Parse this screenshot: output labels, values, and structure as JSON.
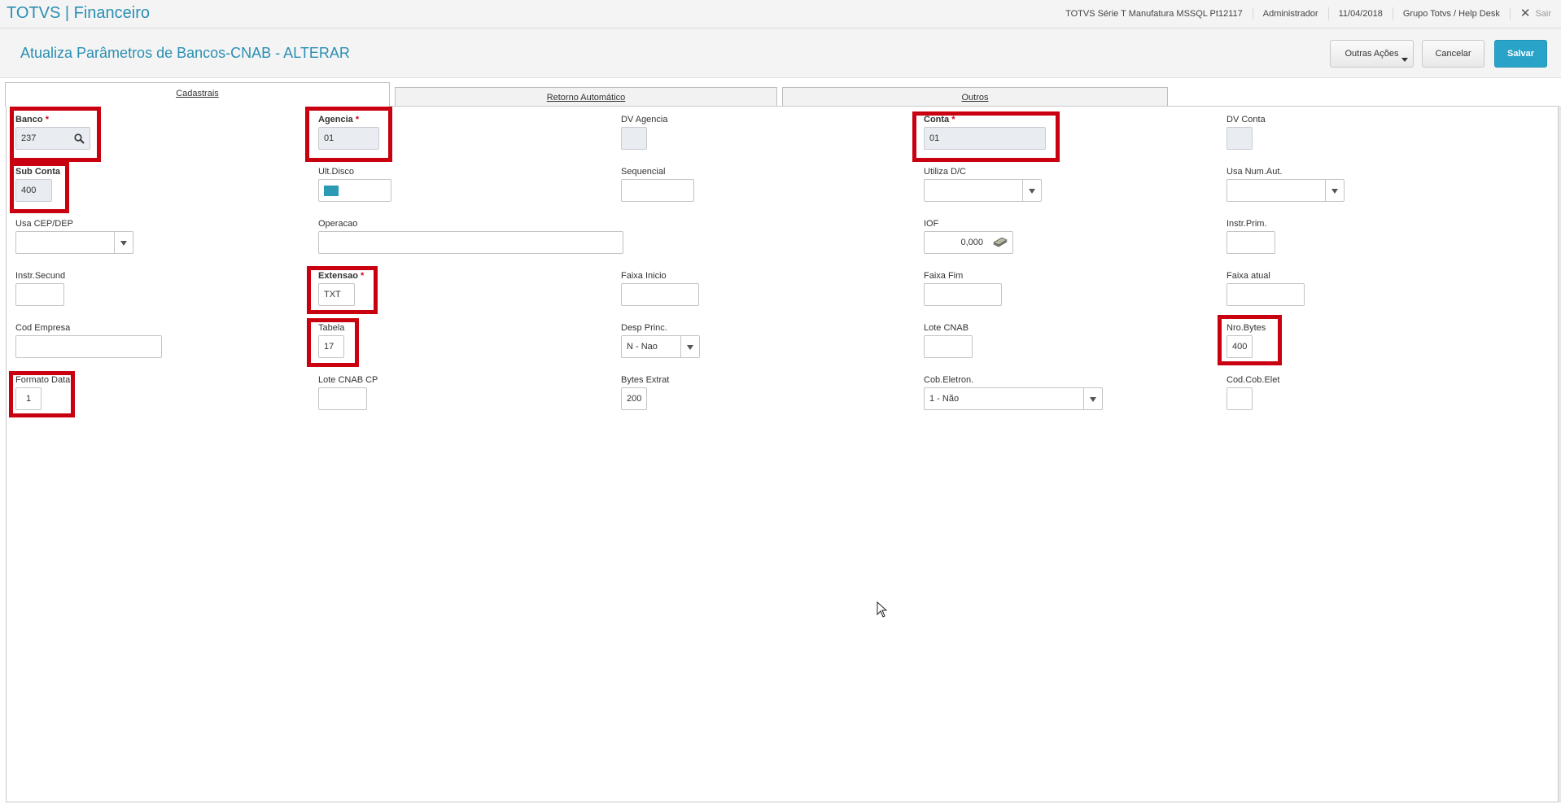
{
  "topbar": {
    "app_title": "TOTVS | Financeiro",
    "environment": "TOTVS Série T Manufatura MSSQL Pt12117",
    "user": "Administrador",
    "date": "11/04/2018",
    "group": "Grupo Totvs / Help Desk",
    "exit_label": "Sair"
  },
  "header": {
    "title": "Atualiza Parâmetros de Bancos-CNAB - ALTERAR",
    "other_actions_label": "Outras Ações",
    "cancel_label": "Cancelar",
    "save_label": "Salvar"
  },
  "tabs": [
    {
      "label": "Cadastrais",
      "active": true
    },
    {
      "label": "Retorno Automático",
      "active": false
    },
    {
      "label": "Outros",
      "active": false
    }
  ],
  "required_mark": "*",
  "fields": {
    "banco": {
      "label": "Banco",
      "value": "237",
      "required": true
    },
    "agencia": {
      "label": "Agencia",
      "value": "01",
      "required": true
    },
    "dv_agencia": {
      "label": "DV Agencia",
      "value": ""
    },
    "conta": {
      "label": "Conta",
      "value": "01",
      "required": true
    },
    "dv_conta": {
      "label": "DV Conta",
      "value": ""
    },
    "sub_conta": {
      "label": "Sub Conta",
      "value": "400"
    },
    "ult_disco": {
      "label": "Ult.Disco",
      "value": ""
    },
    "sequencial": {
      "label": "Sequencial",
      "value": ""
    },
    "utiliza_dc": {
      "label": "Utiliza D/C",
      "value": ""
    },
    "usa_num_aut": {
      "label": "Usa Num.Aut.",
      "value": ""
    },
    "usa_cep_dep": {
      "label": "Usa CEP/DEP",
      "value": ""
    },
    "operacao": {
      "label": "Operacao",
      "value": ""
    },
    "iof": {
      "label": "IOF",
      "value": "0,000"
    },
    "instr_prim": {
      "label": "Instr.Prim.",
      "value": ""
    },
    "instr_secund": {
      "label": "Instr.Secund",
      "value": ""
    },
    "extensao": {
      "label": "Extensao",
      "value": "TXT",
      "required": true
    },
    "faixa_inicio": {
      "label": "Faixa Inicio",
      "value": ""
    },
    "faixa_fim": {
      "label": "Faixa Fim",
      "value": ""
    },
    "faixa_atual": {
      "label": "Faixa atual",
      "value": ""
    },
    "cod_empresa": {
      "label": "Cod Empresa",
      "value": ""
    },
    "tabela": {
      "label": "Tabela",
      "value": "17"
    },
    "desp_princ": {
      "label": "Desp Princ.",
      "value": "N - Nao"
    },
    "lote_cnab": {
      "label": "Lote CNAB",
      "value": ""
    },
    "nro_bytes": {
      "label": "Nro.Bytes",
      "value": "400"
    },
    "formato_data": {
      "label": "Formato Data",
      "value": "1"
    },
    "lote_cnab_cp": {
      "label": "Lote CNAB CP",
      "value": ""
    },
    "bytes_extrat": {
      "label": "Bytes Extrat",
      "value": "200"
    },
    "cob_eletron": {
      "label": "Cob.Eletron.",
      "value": "1 - Não"
    },
    "cod_cob_elet": {
      "label": "Cod.Cob.Elet",
      "value": ""
    }
  },
  "colors": {
    "accent": "#2b8fb3",
    "save_button": "#2aa3c9",
    "highlight_box": "#c8000f",
    "required_mark": "#d9001b"
  },
  "icons": [
    "search-icon",
    "money-icon",
    "chevron-down-icon",
    "close-icon",
    "mouse-cursor-icon"
  ]
}
